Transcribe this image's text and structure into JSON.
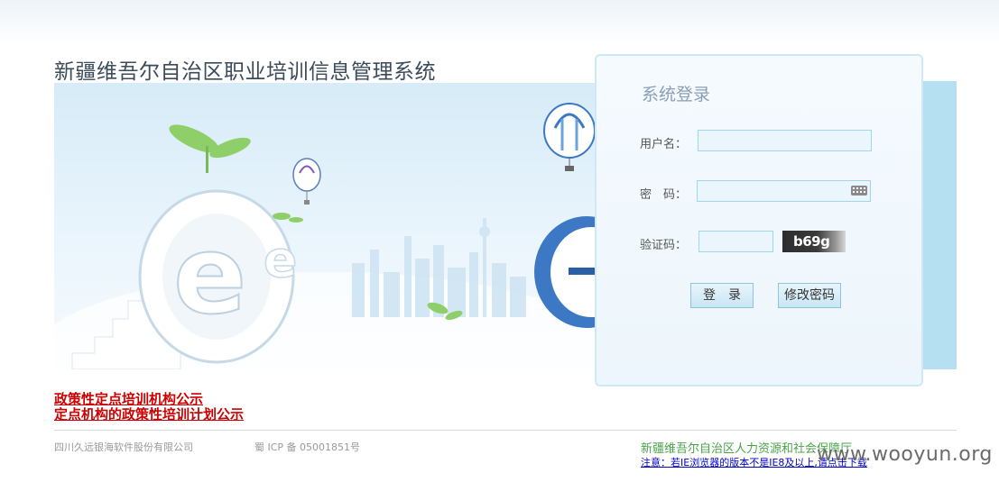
{
  "header": {
    "title": "新疆维吾尔自治区职业培训信息管理系统"
  },
  "login": {
    "title": "系统登录",
    "username_label": "用户名：",
    "password_label": "密　码：",
    "captcha_label": "验证码：",
    "captcha_text": "b69g",
    "login_button": "登　录",
    "change_password_button": "修改密码"
  },
  "notices": [
    "政策性定点培训机构公示",
    "定点机构的政策性培训计划公示"
  ],
  "footer": {
    "company": "四川久远银海软件股份有限公司",
    "icp": "蜀 ICP 备 05001851号",
    "org": "新疆维吾尔自治区人力资源和社会保障厅",
    "browser_notice": "注意：若IE浏览器的版本不是IE8及以上,请点击下载",
    "watermark": "www.wooyun.org"
  },
  "colors": {
    "title": "#3a4b5a",
    "notice_link": "#cc0000",
    "org": "#4aa34a",
    "accent_strip": "#b4e0f2"
  }
}
